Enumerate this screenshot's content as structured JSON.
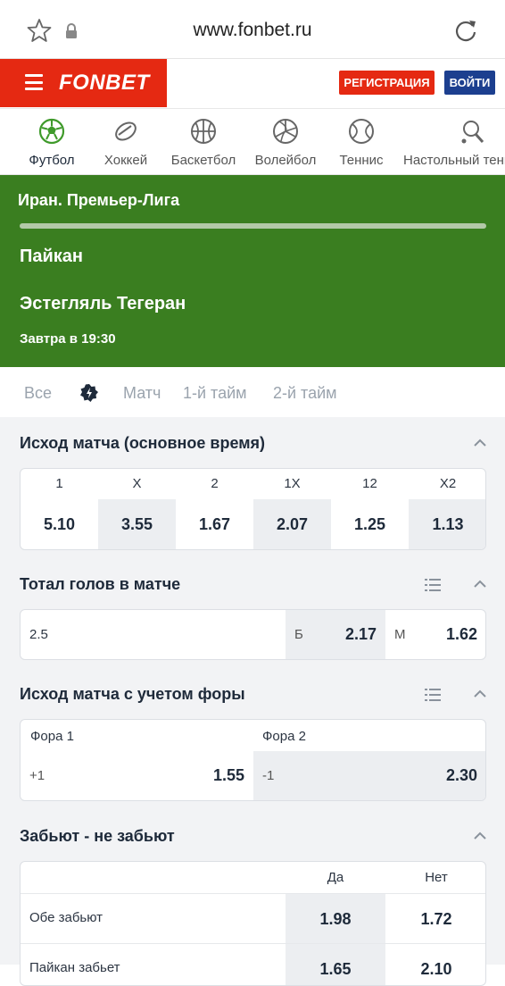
{
  "browser": {
    "url": "www.fonbet.ru"
  },
  "header": {
    "logo": "FONBET",
    "register_label": "РЕГИСТРАЦИЯ",
    "login_label": "ВОЙТИ"
  },
  "sports": [
    {
      "label": "Футбол",
      "icon": "football-icon",
      "active": true
    },
    {
      "label": "Хоккей",
      "icon": "hockey-puck-icon"
    },
    {
      "label": "Баскетбол",
      "icon": "basketball-icon"
    },
    {
      "label": "Волейбол",
      "icon": "volleyball-icon"
    },
    {
      "label": "Теннис",
      "icon": "tennis-ball-icon"
    },
    {
      "label": "Настольный теннис",
      "icon": "table-tennis-icon"
    }
  ],
  "match": {
    "league": "Иран. Премьер-Лига",
    "team1": "Пайкан",
    "team2": "Эстегляль Тегеран",
    "time": "Завтра в 19:30"
  },
  "tabs": [
    "Все",
    "Матч",
    "1-й тайм",
    "2-й тайм"
  ],
  "markets": {
    "result": {
      "title": "Исход матча (основное время)",
      "headers": [
        "1",
        "X",
        "2",
        "1X",
        "12",
        "X2"
      ],
      "odds": [
        "5.10",
        "3.55",
        "1.67",
        "2.07",
        "1.25",
        "1.13"
      ]
    },
    "total": {
      "title": "Тотал голов в матче",
      "line": "2.5",
      "over_label": "Б",
      "over": "2.17",
      "under_label": "М",
      "under": "1.62"
    },
    "handicap": {
      "title": "Исход матча с учетом форы",
      "h1_label": "Фора 1",
      "h1_line": "+1",
      "h1_odd": "1.55",
      "h2_label": "Фора 2",
      "h2_line": "-1",
      "h2_odd": "2.30"
    },
    "btts": {
      "title": "Забьют - не забьют",
      "yes_label": "Да",
      "no_label": "Нет",
      "rows": [
        {
          "label": "Обе забьют",
          "yes": "1.98",
          "no": "1.72"
        },
        {
          "label": "Пайкан забьет",
          "yes": "1.65",
          "no": "2.10"
        }
      ]
    }
  },
  "colors": {
    "brand_red": "#e52912",
    "login_blue": "#1c3f8f",
    "hero_green": "#3a7e20",
    "football_green": "#3f9a2b"
  }
}
